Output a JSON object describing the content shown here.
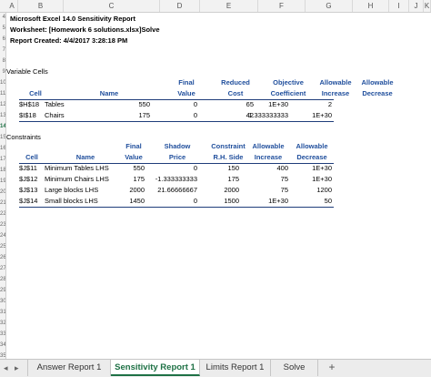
{
  "columns": [
    "A",
    "B",
    "C",
    "D",
    "E",
    "F",
    "G",
    "H",
    "I",
    "J",
    "K"
  ],
  "rows": [
    "4",
    "5",
    "6",
    "7",
    "8",
    "9",
    "10",
    "11",
    "12",
    "13",
    "14",
    "15",
    "16",
    "17",
    "18",
    "19",
    "20",
    "21",
    "22",
    "23",
    "24",
    "25",
    "26",
    "27",
    "28",
    "29",
    "30",
    "31",
    "32",
    "33",
    "34",
    "35"
  ],
  "report": {
    "title": "Microsoft Excel 14.0 Sensitivity Report",
    "worksheet": "Worksheet: [Homework 6 solutions.xlsx]Solve",
    "created": "Report Created: 4/4/2017 3:28:18 PM"
  },
  "variable_cells": {
    "section_label": "Variable Cells",
    "headers_top": [
      "",
      "",
      "Final",
      "Reduced",
      "Objective",
      "Allowable",
      "Allowable"
    ],
    "headers_bottom": [
      "Cell",
      "Name",
      "Value",
      "Cost",
      "Coefficient",
      "Increase",
      "Decrease"
    ],
    "rows": [
      [
        "$H$18",
        "Tables",
        "550",
        "0",
        "65",
        "1E+30",
        "2"
      ],
      [
        "$I$18",
        "Chairs",
        "175",
        "0",
        "42",
        "1.333333333",
        "1E+30"
      ]
    ]
  },
  "constraints": {
    "section_label": "Constraints",
    "headers_top": [
      "",
      "",
      "Final",
      "Shadow",
      "Constraint",
      "Allowable",
      "Allowable"
    ],
    "headers_bottom": [
      "Cell",
      "Name",
      "Value",
      "Price",
      "R.H. Side",
      "Increase",
      "Decrease"
    ],
    "rows": [
      [
        "$J$11",
        "Minimum Tables LHS",
        "550",
        "0",
        "150",
        "400",
        "1E+30"
      ],
      [
        "$J$12",
        "Minimum Chairs LHS",
        "175",
        "-1.333333333",
        "175",
        "75",
        "1E+30"
      ],
      [
        "$J$13",
        "Large blocks  LHS",
        "2000",
        "21.66666667",
        "2000",
        "75",
        "1200"
      ],
      [
        "$J$14",
        "Small blocks LHS",
        "1450",
        "0",
        "1500",
        "1E+30",
        "50"
      ]
    ]
  },
  "tabs": {
    "nav_prev": "◂",
    "nav_next": "▸",
    "items": [
      "Answer Report 1",
      "Sensitivity Report 1",
      "Limits Report 1",
      "Solve"
    ],
    "active_index": 1,
    "add_label": "+"
  },
  "colors": {
    "header_blue": "#1f4e9c",
    "active_tab_green": "#1e7145"
  }
}
